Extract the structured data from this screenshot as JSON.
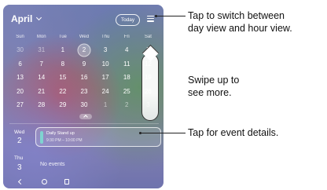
{
  "calendar": {
    "month_label": "April",
    "today_label": "Today",
    "weekdays": [
      "Sun",
      "Mon",
      "Tue",
      "Wed",
      "Thu",
      "Fri",
      "Sat"
    ],
    "days": [
      "30",
      "31",
      "1",
      "2",
      "3",
      "4",
      "5",
      "6",
      "7",
      "8",
      "9",
      "10",
      "11",
      "12",
      "13",
      "14",
      "15",
      "16",
      "17",
      "18",
      "19",
      "20",
      "21",
      "22",
      "23",
      "24",
      "25",
      "26",
      "27",
      "28",
      "29",
      "30",
      "1",
      "2",
      "3"
    ]
  },
  "agenda": {
    "day1": {
      "name": "Wed",
      "num": "2"
    },
    "event": {
      "title": "Daily Stand up",
      "time": "9:30 PM – 10:00 PM"
    },
    "day2": {
      "name": "Thu",
      "num": "3"
    },
    "no_events": "No events"
  },
  "callouts": {
    "menu": "Tap to switch between\nday view and hour view.",
    "swipe": "Swipe up to\nsee more.",
    "event": "Tap for event details."
  },
  "colors": {
    "event_accent": "#7fd3d0"
  }
}
